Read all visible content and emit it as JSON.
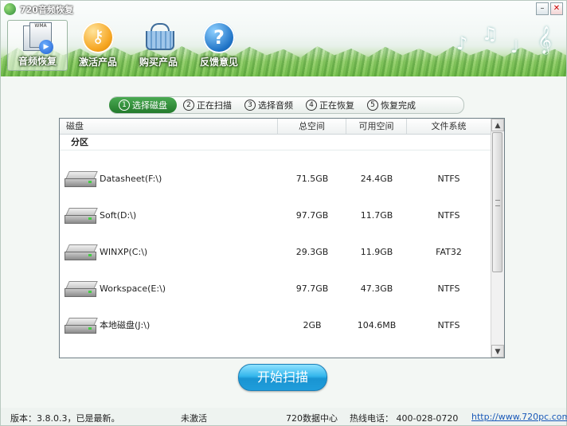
{
  "window": {
    "title": "720音频恢复"
  },
  "toolbar": {
    "items": [
      {
        "label": "音频恢复",
        "icon": "audio-files-icon"
      },
      {
        "label": "激活产品",
        "icon": "key-icon"
      },
      {
        "label": "购买产品",
        "icon": "basket-icon"
      },
      {
        "label": "反馈意见",
        "icon": "help-icon"
      }
    ]
  },
  "steps": [
    {
      "num": "1",
      "label": "选择磁盘"
    },
    {
      "num": "2",
      "label": "正在扫描"
    },
    {
      "num": "3",
      "label": "选择音频"
    },
    {
      "num": "4",
      "label": "正在恢复"
    },
    {
      "num": "5",
      "label": "恢复完成"
    }
  ],
  "table": {
    "headers": {
      "disk": "磁盘",
      "total": "总空间",
      "free": "可用空间",
      "fs": "文件系统"
    },
    "group": "分区",
    "rows": [
      {
        "name": "Datasheet(F:\\)",
        "total": "71.5GB",
        "free": "24.4GB",
        "fs": "NTFS"
      },
      {
        "name": "Soft(D:\\)",
        "total": "97.7GB",
        "free": "11.7GB",
        "fs": "NTFS"
      },
      {
        "name": "WINXP(C:\\)",
        "total": "29.3GB",
        "free": "11.9GB",
        "fs": "FAT32"
      },
      {
        "name": "Workspace(E:\\)",
        "total": "97.7GB",
        "free": "47.3GB",
        "fs": "NTFS"
      },
      {
        "name": "本地磁盘(J:\\)",
        "total": "2GB",
        "free": "104.6MB",
        "fs": "NTFS"
      }
    ]
  },
  "start_button": {
    "label": "开始扫描"
  },
  "status": {
    "version": "版本：3.8.0.3，已是最新。",
    "activation": "未激活",
    "center": "720数据中心",
    "phone": "热线电话： 400-028-0720",
    "url": "http://www.720pc.com"
  },
  "colors": {
    "accent_green": "#237a2c",
    "button_blue": "#1994d2",
    "link": "#1a59b8"
  }
}
